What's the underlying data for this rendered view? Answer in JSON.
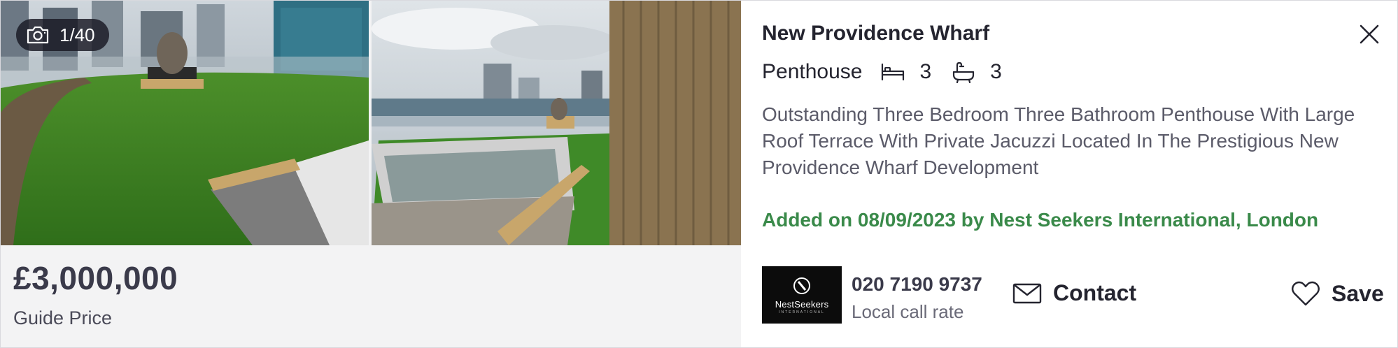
{
  "gallery": {
    "counter_text": "1/40",
    "camera_icon": "camera-icon",
    "images": [
      {
        "alt": "Roof terrace with artificial grass and hot tub"
      },
      {
        "alt": "Hot tub on roof terrace with city skyline"
      }
    ]
  },
  "price": {
    "amount": "£3,000,000",
    "qualifier": "Guide Price"
  },
  "listing": {
    "title": "New Providence Wharf",
    "type": "Penthouse",
    "bedrooms": "3",
    "bathrooms": "3",
    "description": "Outstanding Three Bedroom Three Bathroom Penthouse With Large Roof Terrace With Private Jacuzzi Located In The Prestigious New Providence Wharf Development",
    "added": "Added on 08/09/2023 by Nest Seekers International, London"
  },
  "agent": {
    "logo_text": "NestSeekers",
    "logo_subtext": "INTERNATIONAL",
    "phone": "020 7190 9737",
    "call_rate": "Local call rate"
  },
  "actions": {
    "contact_label": "Contact",
    "save_label": "Save"
  },
  "colors": {
    "accent_green": "#3a8a4a",
    "text_dark": "#24242f",
    "panel_bg": "#f3f3f4"
  }
}
